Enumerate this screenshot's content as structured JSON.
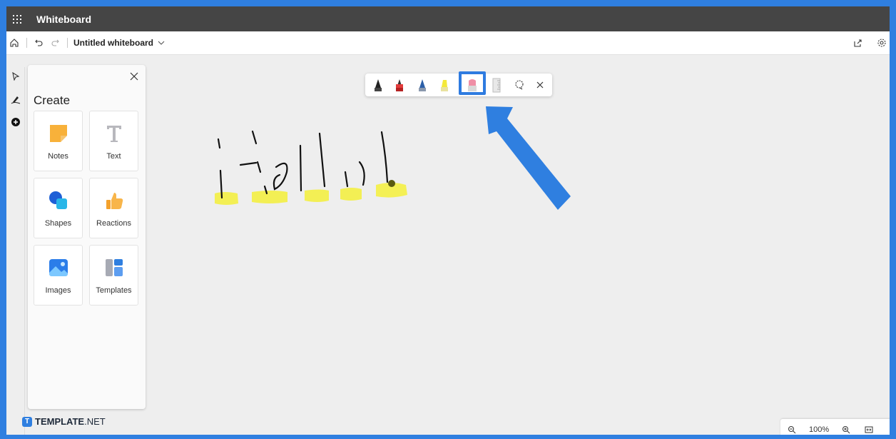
{
  "app": {
    "title": "Whiteboard"
  },
  "command_bar": {
    "document_title": "Untitled whiteboard"
  },
  "create_panel": {
    "title": "Create",
    "items": [
      {
        "label": "Notes",
        "icon": "notes-icon"
      },
      {
        "label": "Text",
        "icon": "text-icon"
      },
      {
        "label": "Shapes",
        "icon": "shapes-icon"
      },
      {
        "label": "Reactions",
        "icon": "thumbs-up-icon"
      },
      {
        "label": "Images",
        "icon": "image-icon"
      },
      {
        "label": "Templates",
        "icon": "templates-icon"
      }
    ]
  },
  "ink_toolbar": {
    "tools": [
      "black-pen",
      "red-pen",
      "blue-pen",
      "yellow-highlighter",
      "eraser",
      "ruler",
      "lasso-select",
      "close"
    ],
    "selected": "eraser"
  },
  "canvas": {
    "handwriting": "Hello!"
  },
  "zoom": {
    "level": "100%"
  },
  "watermark": {
    "brand_bold": "TEMPLATE",
    "brand_suffix": ".NET"
  },
  "colors": {
    "accent": "#2f7fe0",
    "highlighter": "#f4f03a",
    "appbar": "#454545"
  }
}
